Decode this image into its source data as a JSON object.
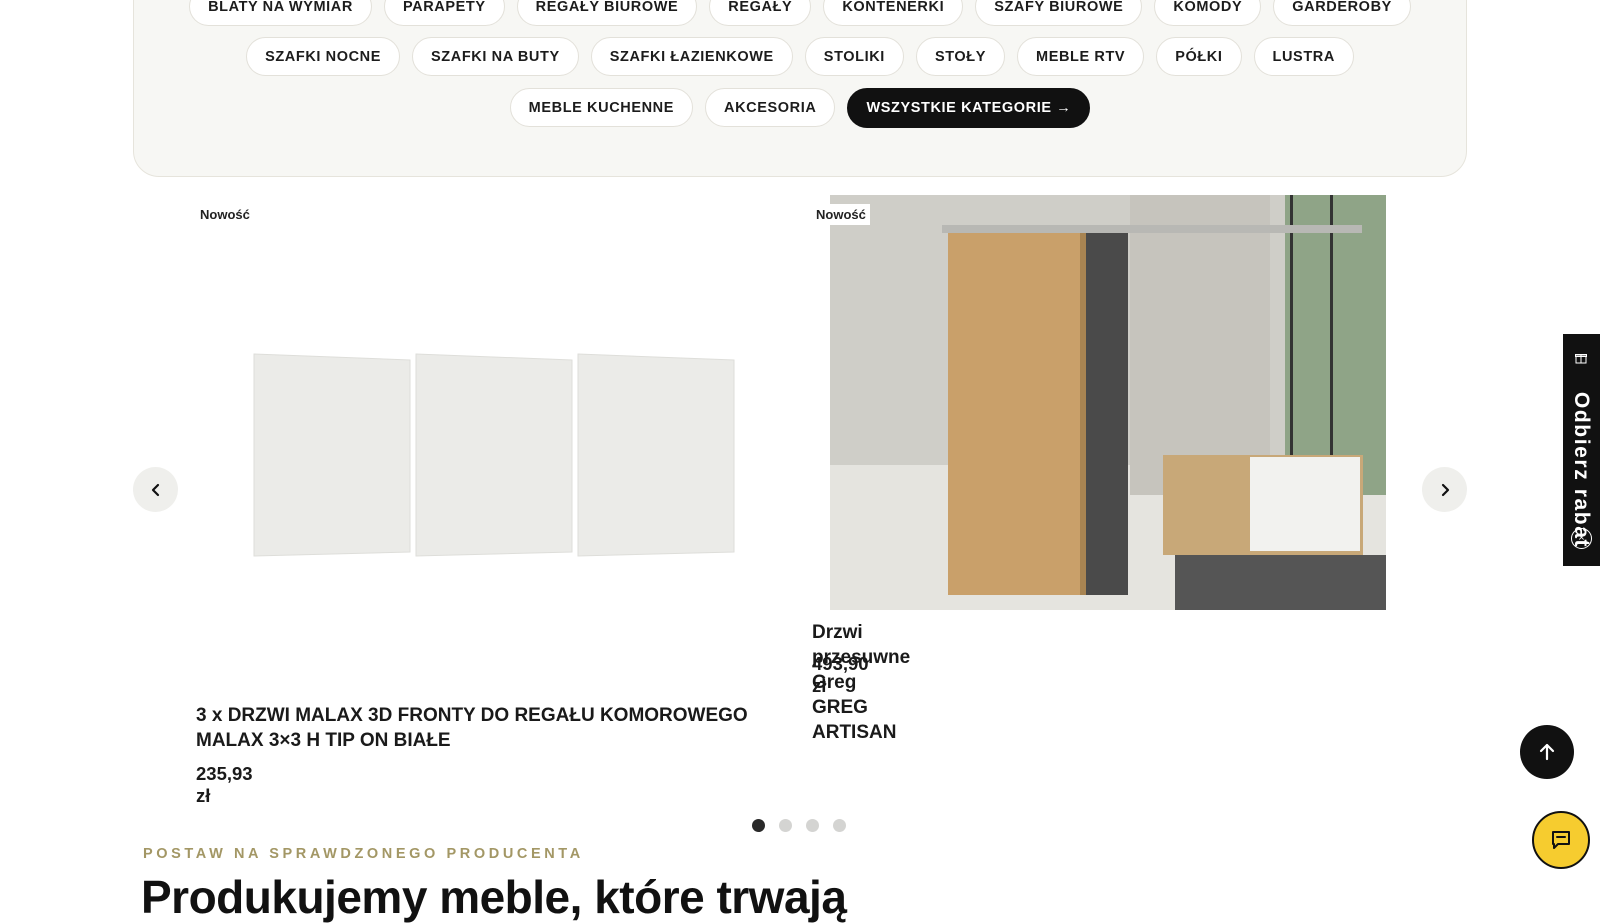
{
  "categories": {
    "row1": [
      "BLATY NA WYMIAR",
      "PARAPETY",
      "REGAŁY BIUROWE",
      "REGAŁY",
      "KONTENERKI",
      "SZAFY BIUROWE",
      "KOMODY",
      "GARDEROBY"
    ],
    "row2": [
      "SZAFKI NOCNE",
      "SZAFKI NA BUTY",
      "SZAFKI ŁAZIENKOWE",
      "STOLIKI",
      "STOŁY",
      "MEBLE RTV",
      "PÓŁKI",
      "LUSTRA"
    ],
    "row3": [
      "MEBLE KUCHENNE",
      "AKCESORIA"
    ],
    "all_label": "WSZYSTKIE KATEGORIE →"
  },
  "carousel": {
    "products": [
      {
        "badge": "Nowość",
        "title": "3 x DRZWI MALAX 3D FRONTY DO REGAŁU KOMOROWEGO MALAX 3×3 H TIP ON BIAŁE",
        "price": "235,93 zł"
      },
      {
        "badge": "Nowość",
        "title": "Drzwi przesuwne Greg GREG ARTISAN",
        "price": "493,90 zł"
      }
    ],
    "prev_icon": "chevron-left-icon",
    "next_icon": "chevron-right-icon",
    "pagination": {
      "total": 4,
      "active": 1
    }
  },
  "section": {
    "eyebrow": "POSTAW NA SPRAWDZONEGO PRODUCENTA",
    "heading": "Produkujemy meble, które trwają"
  },
  "side_tab": {
    "label": "Odbierz rabat",
    "icon": "gift-icon",
    "close": "×"
  },
  "floating": {
    "to_top_icon": "arrow-up-icon",
    "chat_icon": "chat-icon"
  },
  "colors": {
    "accent_gold": "#a39765",
    "chat_yellow": "#f6cc2f",
    "dark": "#111111"
  }
}
